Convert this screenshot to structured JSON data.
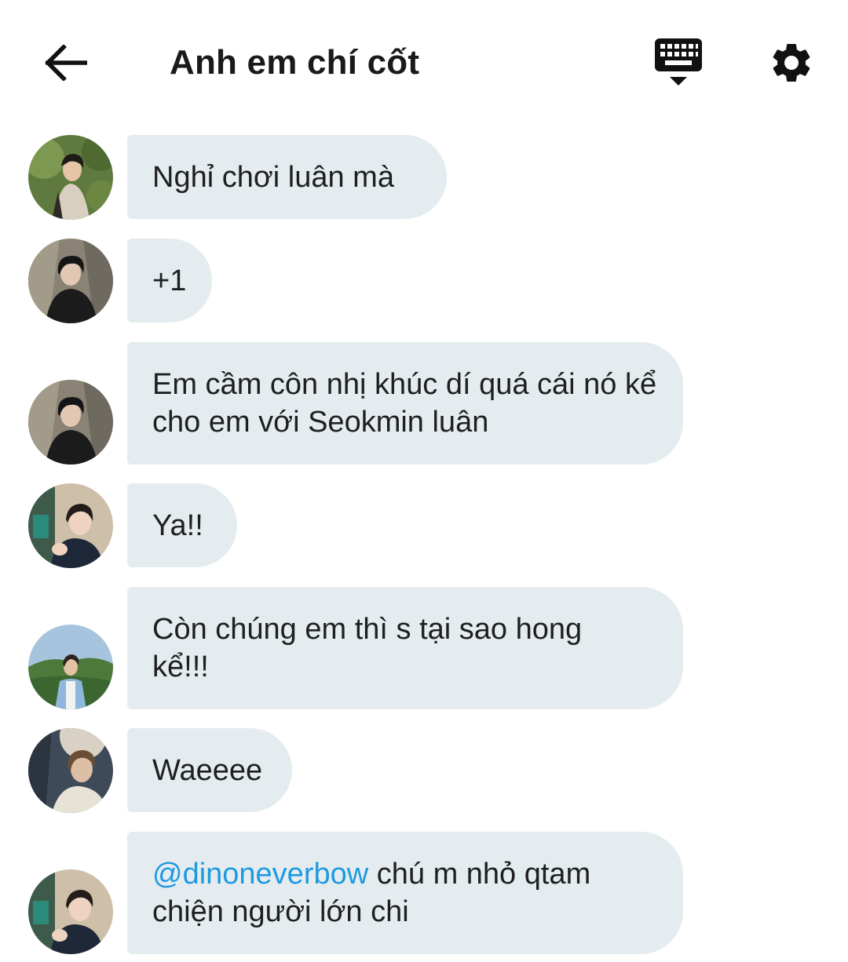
{
  "header": {
    "title": "Anh em chí cốt",
    "back_icon": "arrow-left-icon",
    "keyboard_icon": "keyboard-hide-icon",
    "settings_icon": "gear-icon"
  },
  "colors": {
    "bubble_bg": "#e4ecef",
    "mention": "#1e9ae0",
    "text": "#1f1f1f"
  },
  "messages": [
    {
      "text": "Nghỉ chơi luân mà"
    },
    {
      "text": "+1"
    },
    {
      "text": "Em cầm côn nhị khúc dí quá cái nó kể cho em với Seokmin luân"
    },
    {
      "text": "Ya!!"
    },
    {
      "text": "Còn chúng em thì s tại sao hong kể!!!"
    },
    {
      "text": "Waeeee"
    },
    {
      "mention": "@dinoneverbow",
      "text": " chú m nhỏ qtam chiện người lớn chi"
    }
  ]
}
